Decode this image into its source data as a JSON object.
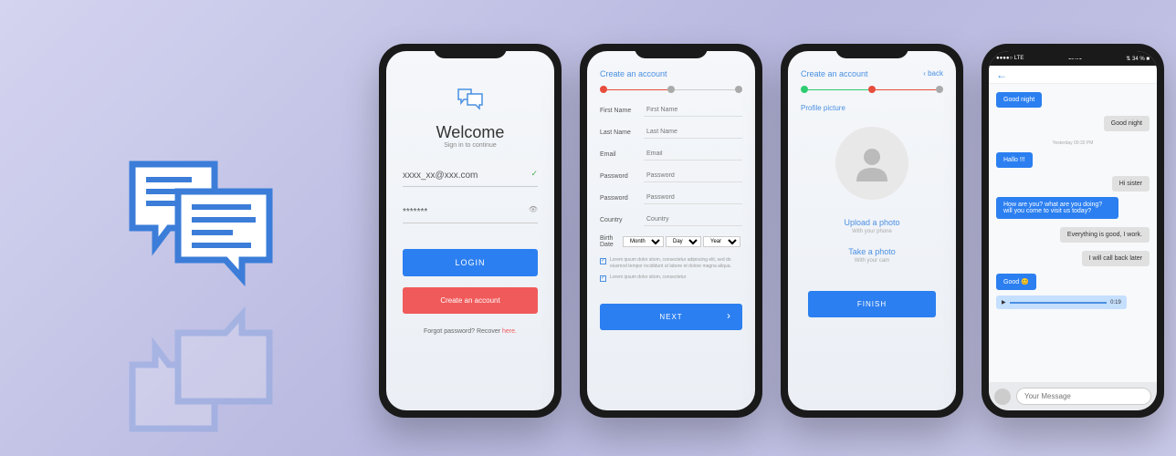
{
  "login": {
    "title": "Welcome",
    "subtitle": "Sign in to continue",
    "email": "xxxx_xx@xxx.com",
    "password": "*******",
    "login_btn": "LOGIN",
    "create_btn": "Create an account",
    "forgot": "Forgot password?  Recover ",
    "here": "here."
  },
  "signup": {
    "header": "Create an account",
    "fields": {
      "first_name_label": "First Name",
      "first_name_ph": "First Name",
      "last_name_label": "Last Name",
      "last_name_ph": "Last Name",
      "email_label": "Email",
      "email_ph": "Email",
      "password_label": "Password",
      "password_ph": "Password",
      "password2_label": "Password",
      "password2_ph": "Password",
      "country_label": "Country",
      "country_ph": "Country",
      "birth_label": "Birth Date",
      "month": "Month",
      "day": "Day",
      "year": "Year"
    },
    "check1": "Lorem ipsum dolor sitom, consectetur adipiscing elit, sed do eiusmod tempor incididunt ut labore et dolore magna aliqua.",
    "check2": "Lorem ipsum dolor sitom, consectetur",
    "next_btn": "NEXT"
  },
  "profile": {
    "header": "Create an account",
    "back": "‹ back",
    "subtitle": "Profile picture",
    "upload": "Upload a photo",
    "upload_sub": "With your phone",
    "take": "Take a photo",
    "take_sub": "With your cam",
    "finish_btn": "FINISH"
  },
  "chat": {
    "status_left": "●●●●○ LTE",
    "status_time": "19:01",
    "status_right": "⇅ 34 % ■",
    "msgs": {
      "m1": "Good night",
      "m2": "Good night",
      "date": "Yesterday 00:32 PM",
      "m3": "Hallo !!!",
      "m4": "Hi sister",
      "m5": "How are you? what are you doing? will you come to visit us today?",
      "m6": "Everything is good, I work.",
      "m7": "I will call back later",
      "m8": "Good 😊",
      "audio_time": "0:19"
    },
    "input_ph": "Your Message"
  }
}
